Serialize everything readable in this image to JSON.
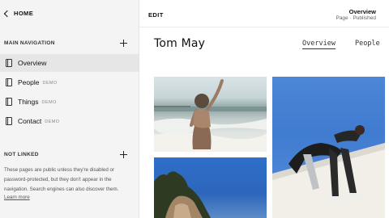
{
  "sidebar": {
    "home_label": "HOME",
    "main_nav_title": "MAIN NAVIGATION",
    "items": [
      {
        "label": "Overview",
        "badge": ""
      },
      {
        "label": "People",
        "badge": "DEMO"
      },
      {
        "label": "Things",
        "badge": "DEMO"
      },
      {
        "label": "Contact",
        "badge": "DEMO"
      }
    ],
    "not_linked_title": "NOT LINKED",
    "not_linked_help": "These pages are public unless they're disabled or password-protected, but they don't appear in the navigation. Search engines can also discover them.",
    "learn_more": "Learn more"
  },
  "editor": {
    "edit_label": "EDIT",
    "page_title": "Overview",
    "page_status": "Page · Published"
  },
  "site": {
    "title": "Tom May",
    "nav": [
      "Overview",
      "People"
    ]
  },
  "colors": {
    "sidebar_bg": "#f4f4f4",
    "active_item_bg": "#e6e6e6",
    "sky_blue": "#3f7bd0"
  }
}
